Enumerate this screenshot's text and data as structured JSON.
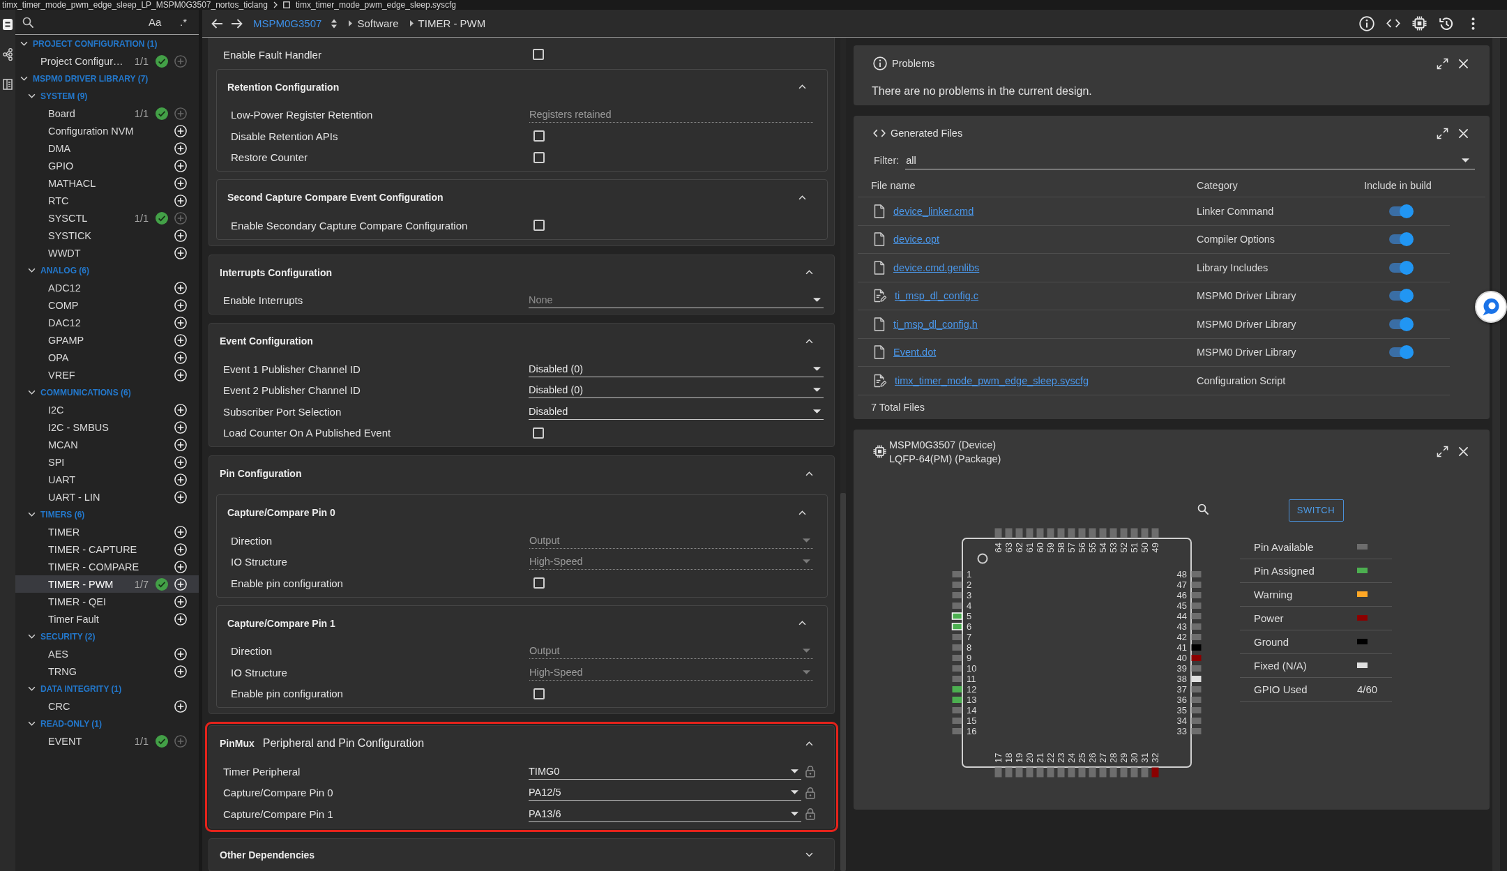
{
  "title_bar": {
    "project": "timx_timer_mode_pwm_edge_sleep_LP_MSPM0G3507_nortos_ticlang",
    "file": "timx_timer_mode_pwm_edge_sleep.syscfg"
  },
  "sidebar": {
    "search": {
      "case_toggle": "Aa",
      "regex_toggle": ".*"
    },
    "tree": [
      {
        "kind": "group",
        "label": "PROJECT CONFIGURATION (1)",
        "expanded": true,
        "children": [
          {
            "kind": "module",
            "label": "Project Configur…",
            "count": "1/1",
            "valid": true,
            "add_disabled": true,
            "selected": false
          }
        ]
      },
      {
        "kind": "group",
        "label": "MSPM0 DRIVER LIBRARY (7)",
        "expanded": true,
        "children": [
          {
            "kind": "group",
            "label": "SYSTEM (9)",
            "expanded": true,
            "children": [
              {
                "kind": "module",
                "label": "Board",
                "count": "1/1",
                "valid": true,
                "add_disabled": true,
                "selected": false
              },
              {
                "kind": "module",
                "label": "Configuration NVM",
                "valid": false,
                "add_disabled": false,
                "selected": false
              },
              {
                "kind": "module",
                "label": "DMA",
                "valid": false,
                "add_disabled": false,
                "selected": false
              },
              {
                "kind": "module",
                "label": "GPIO",
                "valid": false,
                "add_disabled": false,
                "selected": false
              },
              {
                "kind": "module",
                "label": "MATHACL",
                "valid": false,
                "add_disabled": false,
                "selected": false
              },
              {
                "kind": "module",
                "label": "RTC",
                "valid": false,
                "add_disabled": false,
                "selected": false
              },
              {
                "kind": "module",
                "label": "SYSCTL",
                "count": "1/1",
                "valid": true,
                "add_disabled": true,
                "selected": false
              },
              {
                "kind": "module",
                "label": "SYSTICK",
                "valid": false,
                "add_disabled": false,
                "selected": false
              },
              {
                "kind": "module",
                "label": "WWDT",
                "valid": false,
                "add_disabled": false,
                "selected": false
              }
            ]
          },
          {
            "kind": "group",
            "label": "ANALOG (6)",
            "expanded": true,
            "children": [
              {
                "kind": "module",
                "label": "ADC12",
                "valid": false,
                "add_disabled": false,
                "selected": false
              },
              {
                "kind": "module",
                "label": "COMP",
                "valid": false,
                "add_disabled": false,
                "selected": false
              },
              {
                "kind": "module",
                "label": "DAC12",
                "valid": false,
                "add_disabled": false,
                "selected": false
              },
              {
                "kind": "module",
                "label": "GPAMP",
                "valid": false,
                "add_disabled": false,
                "selected": false
              },
              {
                "kind": "module",
                "label": "OPA",
                "valid": false,
                "add_disabled": false,
                "selected": false
              },
              {
                "kind": "module",
                "label": "VREF",
                "valid": false,
                "add_disabled": false,
                "selected": false
              }
            ]
          },
          {
            "kind": "group",
            "label": "COMMUNICATIONS (6)",
            "expanded": true,
            "children": [
              {
                "kind": "module",
                "label": "I2C",
                "valid": false,
                "add_disabled": false,
                "selected": false
              },
              {
                "kind": "module",
                "label": "I2C - SMBUS",
                "valid": false,
                "add_disabled": false,
                "selected": false
              },
              {
                "kind": "module",
                "label": "MCAN",
                "valid": false,
                "add_disabled": false,
                "selected": false
              },
              {
                "kind": "module",
                "label": "SPI",
                "valid": false,
                "add_disabled": false,
                "selected": false
              },
              {
                "kind": "module",
                "label": "UART",
                "valid": false,
                "add_disabled": false,
                "selected": false
              },
              {
                "kind": "module",
                "label": "UART - LIN",
                "valid": false,
                "add_disabled": false,
                "selected": false
              }
            ]
          },
          {
            "kind": "group",
            "label": "TIMERS (6)",
            "expanded": true,
            "children": [
              {
                "kind": "module",
                "label": "TIMER",
                "valid": false,
                "add_disabled": false,
                "selected": false
              },
              {
                "kind": "module",
                "label": "TIMER - CAPTURE",
                "valid": false,
                "add_disabled": false,
                "selected": false
              },
              {
                "kind": "module",
                "label": "TIMER - COMPARE",
                "valid": false,
                "add_disabled": false,
                "selected": false
              },
              {
                "kind": "module",
                "label": "TIMER - PWM",
                "count": "1/7",
                "valid": true,
                "add_disabled": false,
                "selected": true
              },
              {
                "kind": "module",
                "label": "TIMER - QEI",
                "valid": false,
                "add_disabled": false,
                "selected": false
              },
              {
                "kind": "module",
                "label": "Timer Fault",
                "valid": false,
                "add_disabled": false,
                "selected": false
              }
            ]
          },
          {
            "kind": "group",
            "label": "SECURITY (2)",
            "expanded": true,
            "children": [
              {
                "kind": "module",
                "label": "AES",
                "valid": false,
                "add_disabled": false,
                "selected": false
              },
              {
                "kind": "module",
                "label": "TRNG",
                "valid": false,
                "add_disabled": false,
                "selected": false
              }
            ]
          },
          {
            "kind": "group",
            "label": "DATA INTEGRITY (1)",
            "expanded": true,
            "children": [
              {
                "kind": "module",
                "label": "CRC",
                "valid": false,
                "add_disabled": false,
                "selected": false
              }
            ]
          },
          {
            "kind": "group",
            "label": "READ-ONLY (1)",
            "expanded": true,
            "children": [
              {
                "kind": "module",
                "label": "EVENT",
                "count": "1/1",
                "valid": true,
                "add_disabled": true,
                "selected": false
              }
            ]
          }
        ]
      }
    ]
  },
  "navigation": {
    "breadcrumb": [
      {
        "kind": "device",
        "label": "MSPM0G3507"
      },
      {
        "kind": "crumb",
        "label": "Software"
      },
      {
        "kind": "crumb",
        "label": "TIMER - PWM"
      }
    ]
  },
  "config": {
    "sections": [
      {
        "highlighted": false,
        "rows": [
          {
            "kind": "checkbox",
            "label": "Enable Fault Handler",
            "checked": false
          }
        ],
        "subsections": [
          {
            "title": "Retention Configuration",
            "expanded": true,
            "rows": [
              {
                "kind": "text",
                "label": "Low-Power Register Retention",
                "value": "Registers retained",
                "readonly": true
              },
              {
                "kind": "checkbox",
                "label": "Disable Retention APIs",
                "checked": false
              },
              {
                "kind": "checkbox",
                "label": "Restore Counter",
                "checked": false
              }
            ]
          },
          {
            "title": "Second Capture Compare Event Configuration",
            "expanded": true,
            "rows": [
              {
                "kind": "checkbox",
                "label": "Enable Secondary Capture Compare Configuration",
                "checked": false
              }
            ]
          }
        ]
      },
      {
        "title": "Interrupts Configuration",
        "expanded": true,
        "highlighted": false,
        "rows": [
          {
            "kind": "select",
            "label": "Enable Interrupts",
            "placeholder": "None",
            "readonly": false
          }
        ]
      },
      {
        "title": "Event Configuration",
        "expanded": true,
        "highlighted": false,
        "rows": [
          {
            "kind": "select",
            "label": "Event 1 Publisher Channel ID",
            "value": "Disabled (0)",
            "readonly": false
          },
          {
            "kind": "select",
            "label": "Event 2 Publisher Channel ID",
            "value": "Disabled (0)",
            "readonly": false
          },
          {
            "kind": "select",
            "label": "Subscriber Port Selection",
            "value": "Disabled",
            "readonly": false
          },
          {
            "kind": "checkbox",
            "label": "Load Counter On A Published Event",
            "checked": false
          }
        ]
      },
      {
        "title": "Pin Configuration",
        "expanded": true,
        "highlighted": false,
        "subsections": [
          {
            "title": "Capture/Compare Pin 0",
            "expanded": true,
            "rows": [
              {
                "kind": "select",
                "label": "Direction",
                "value": "Output",
                "readonly": true
              },
              {
                "kind": "select",
                "label": "IO Structure",
                "value": "High-Speed",
                "readonly": true
              },
              {
                "kind": "checkbox",
                "label": "Enable pin configuration",
                "checked": false
              }
            ]
          },
          {
            "title": "Capture/Compare Pin 1",
            "expanded": true,
            "rows": [
              {
                "kind": "select",
                "label": "Direction",
                "value": "Output",
                "readonly": true
              },
              {
                "kind": "select",
                "label": "IO Structure",
                "value": "High-Speed",
                "readonly": true
              },
              {
                "kind": "checkbox",
                "label": "Enable pin configuration",
                "checked": false
              }
            ]
          }
        ]
      },
      {
        "tag": "PinMux",
        "title": "Peripheral and Pin Configuration",
        "expanded": true,
        "highlighted": true,
        "rows": [
          {
            "kind": "select",
            "label": "Timer Peripheral",
            "value": "TIMG0",
            "readonly": false,
            "locked": false
          },
          {
            "kind": "select",
            "label": "Capture/Compare Pin 0",
            "value": "PA12/5",
            "readonly": false,
            "locked": false
          },
          {
            "kind": "select",
            "label": "Capture/Compare Pin 1",
            "value": "PA13/6",
            "readonly": false,
            "locked": false
          }
        ]
      },
      {
        "title": "Other Dependencies",
        "expanded": false,
        "highlighted": false
      }
    ]
  },
  "problems": {
    "title": "Problems",
    "message": "There are no problems in the current design."
  },
  "generated_files": {
    "title": "Generated Files",
    "filter": {
      "label": "Filter:",
      "value": "all"
    },
    "columns": [
      "File name",
      "Category",
      "Include in build"
    ],
    "rows": [
      {
        "name": "device_linker.cmd",
        "kind": "plain",
        "category": "Linker Command",
        "include": true
      },
      {
        "name": "device.opt",
        "kind": "plain",
        "category": "Compiler Options",
        "include": true
      },
      {
        "name": "device.cmd.genlibs",
        "kind": "plain",
        "category": "Library Includes",
        "include": true
      },
      {
        "name": "ti_msp_dl_config.c",
        "kind": "edited",
        "category": "MSPM0 Driver Library",
        "include": true
      },
      {
        "name": "ti_msp_dl_config.h",
        "kind": "plain",
        "category": "MSPM0 Driver Library",
        "include": true
      },
      {
        "name": "Event.dot",
        "kind": "plain",
        "category": "MSPM0 Driver Library",
        "include": true
      },
      {
        "name": "timx_timer_mode_pwm_edge_sleep.syscfg",
        "kind": "edited",
        "category": "Configuration Script"
      }
    ],
    "total": "7 Total Files"
  },
  "device_view": {
    "device": "MSPM0G3507 (Device)",
    "package": "LQFP-64(PM) (Package)",
    "switch_button": "SWITCH",
    "pins": {
      "left": [
        {
          "number": "1",
          "kind": "available",
          "selected": false
        },
        {
          "number": "2",
          "kind": "available",
          "selected": false
        },
        {
          "number": "3",
          "kind": "available",
          "selected": false
        },
        {
          "number": "4",
          "kind": "available",
          "selected": false
        },
        {
          "number": "5",
          "kind": "assigned",
          "selected": true
        },
        {
          "number": "6",
          "kind": "assigned",
          "selected": true
        },
        {
          "number": "7",
          "kind": "available",
          "selected": false
        },
        {
          "number": "8",
          "kind": "available",
          "selected": false
        },
        {
          "number": "9",
          "kind": "available",
          "selected": false
        },
        {
          "number": "10",
          "kind": "available",
          "selected": false
        },
        {
          "number": "11",
          "kind": "available",
          "selected": false
        },
        {
          "number": "12",
          "kind": "assigned",
          "selected": false
        },
        {
          "number": "13",
          "kind": "assigned",
          "selected": false
        },
        {
          "number": "14",
          "kind": "available",
          "selected": false
        },
        {
          "number": "15",
          "kind": "available",
          "selected": false
        },
        {
          "number": "16",
          "kind": "available",
          "selected": false
        }
      ],
      "bottom": [
        {
          "number": "17",
          "kind": "available",
          "selected": false
        },
        {
          "number": "18",
          "kind": "available",
          "selected": false
        },
        {
          "number": "19",
          "kind": "available",
          "selected": false
        },
        {
          "number": "20",
          "kind": "available",
          "selected": false
        },
        {
          "number": "21",
          "kind": "available",
          "selected": false
        },
        {
          "number": "22",
          "kind": "available",
          "selected": false
        },
        {
          "number": "23",
          "kind": "available",
          "selected": false
        },
        {
          "number": "24",
          "kind": "available",
          "selected": false
        },
        {
          "number": "25",
          "kind": "available",
          "selected": false
        },
        {
          "number": "26",
          "kind": "available",
          "selected": false
        },
        {
          "number": "27",
          "kind": "available",
          "selected": false
        },
        {
          "number": "28",
          "kind": "available",
          "selected": false
        },
        {
          "number": "29",
          "kind": "available",
          "selected": false
        },
        {
          "number": "30",
          "kind": "available",
          "selected": false
        },
        {
          "number": "31",
          "kind": "available",
          "selected": false
        },
        {
          "number": "32",
          "kind": "power",
          "selected": false
        }
      ],
      "right": [
        {
          "number": "48",
          "kind": "available",
          "selected": false
        },
        {
          "number": "47",
          "kind": "available",
          "selected": false
        },
        {
          "number": "46",
          "kind": "available",
          "selected": false
        },
        {
          "number": "45",
          "kind": "available",
          "selected": false
        },
        {
          "number": "44",
          "kind": "available",
          "selected": false
        },
        {
          "number": "43",
          "kind": "available",
          "selected": false
        },
        {
          "number": "42",
          "kind": "available",
          "selected": false
        },
        {
          "number": "41",
          "kind": "ground",
          "selected": false
        },
        {
          "number": "40",
          "kind": "power",
          "selected": false
        },
        {
          "number": "39",
          "kind": "available",
          "selected": false
        },
        {
          "number": "38",
          "kind": "fixed",
          "selected": false
        },
        {
          "number": "37",
          "kind": "available",
          "selected": false
        },
        {
          "number": "36",
          "kind": "available",
          "selected": false
        },
        {
          "number": "35",
          "kind": "available",
          "selected": false
        },
        {
          "number": "34",
          "kind": "available",
          "selected": false
        },
        {
          "number": "33",
          "kind": "available",
          "selected": false
        }
      ],
      "top": [
        {
          "number": "64",
          "kind": "available",
          "selected": false
        },
        {
          "number": "63",
          "kind": "available",
          "selected": false
        },
        {
          "number": "62",
          "kind": "available",
          "selected": false
        },
        {
          "number": "61",
          "kind": "available",
          "selected": false
        },
        {
          "number": "60",
          "kind": "available",
          "selected": false
        },
        {
          "number": "59",
          "kind": "available",
          "selected": false
        },
        {
          "number": "58",
          "kind": "available",
          "selected": false
        },
        {
          "number": "57",
          "kind": "available",
          "selected": false
        },
        {
          "number": "56",
          "kind": "available",
          "selected": false
        },
        {
          "number": "55",
          "kind": "available",
          "selected": false
        },
        {
          "number": "54",
          "kind": "available",
          "selected": false
        },
        {
          "number": "53",
          "kind": "available",
          "selected": false
        },
        {
          "number": "52",
          "kind": "available",
          "selected": false
        },
        {
          "number": "51",
          "kind": "available",
          "selected": false
        },
        {
          "number": "50",
          "kind": "available",
          "selected": false
        },
        {
          "number": "49",
          "kind": "available",
          "selected": false
        }
      ]
    },
    "legend": [
      {
        "label": "Pin Available",
        "kind": "available",
        "color": "#6d6d6d"
      },
      {
        "label": "Pin Assigned",
        "kind": "assigned",
        "color": "#4caf50"
      },
      {
        "label": "Warning",
        "kind": "warning",
        "color": "#ffa726"
      },
      {
        "label": "Power",
        "kind": "power",
        "color": "#8b0000"
      },
      {
        "label": "Ground",
        "kind": "ground",
        "color": "#000000"
      },
      {
        "label": "Fixed (N/A)",
        "kind": "fixed",
        "color": "#e0e0e0"
      }
    ],
    "gpio_used": {
      "label": "GPIO Used",
      "value": "4/60"
    }
  }
}
